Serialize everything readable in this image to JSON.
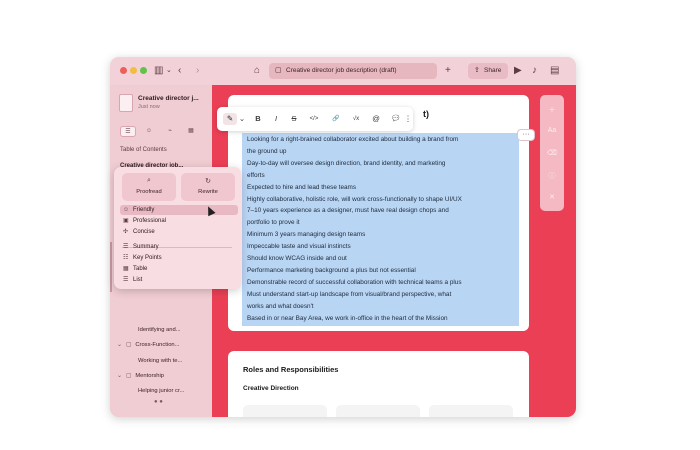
{
  "window": {
    "tab_title": "Creative director job description (draft)",
    "share_label": "Share",
    "icons": [
      "home-icon",
      "sidebar-toggle-icon",
      "back-icon",
      "forward-icon",
      "add-tab-icon",
      "present-icon",
      "notifications-off-icon",
      "window-layout-icon"
    ]
  },
  "sidebar": {
    "doc_title": "Creative director j...",
    "doc_subtitle": "Just now",
    "toc_label": "Table of Contents",
    "current_heading": "Creative director job...",
    "items": [
      {
        "label": "Identifying and...",
        "level": 2
      },
      {
        "label": "Cross-Function...",
        "level": 1
      },
      {
        "label": "Working with te...",
        "level": 2
      },
      {
        "label": "Mentorship",
        "level": 1
      },
      {
        "label": "Helping junior cr...",
        "level": 2
      }
    ]
  },
  "editor": {
    "card1_title": "t)",
    "selected_lines": [
      "Looking for a right-brained collaborator excited about building a brand from",
      "the ground up",
      "Day-to-day will oversee design direction, brand identity, and marketing",
      "efforts",
      "Expected to hire and lead these teams",
      "Highly collaborative, holistic role, will work cross-functionally to shape UI/UX",
      "7–10 years experience as a designer, must have real design chops and",
      "portfolio to prove it",
      "Minimum 3 years managing design teams",
      "Impeccable taste and visual instincts",
      "Should know WCAG inside and out",
      "Performance marketing background a plus but not essential",
      "Demonstrable record of successful collaboration with technical teams a plus",
      "Must understand start-up landscape from visual/brand perspective, what",
      "works and what doesn't",
      "Based in or near Bay Area, we work in-office in the heart of the Mission"
    ],
    "card2_title": "Roles and Responsibilities",
    "card2_subtitle": "Creative Direction",
    "more_label": "···"
  },
  "format_bar": {
    "items": [
      {
        "name": "pen-icon",
        "glyph": "✎",
        "active": true
      },
      {
        "name": "chevron-down-icon",
        "glyph": "⌄",
        "active": false
      },
      {
        "name": "bold-icon",
        "glyph": "B",
        "active": false
      },
      {
        "name": "italic-icon",
        "glyph": "I",
        "active": false
      },
      {
        "name": "strikethrough-icon",
        "glyph": "S",
        "active": false
      },
      {
        "name": "code-icon",
        "glyph": "</>",
        "active": false
      },
      {
        "name": "link-icon",
        "glyph": "🔗",
        "active": false
      },
      {
        "name": "math-icon",
        "glyph": "√x",
        "active": false
      },
      {
        "name": "mention-icon",
        "glyph": "@",
        "active": false
      },
      {
        "name": "comment-icon",
        "glyph": "💬",
        "active": false
      },
      {
        "name": "more-icon",
        "glyph": "⋮",
        "active": false
      }
    ]
  },
  "writing_tools": {
    "proofread_label": "Proofread",
    "rewrite_label": "Rewrite",
    "tone_items": [
      "Friendly",
      "Professional",
      "Concise"
    ],
    "transform_items": [
      "Summary",
      "Key Points",
      "Table",
      "List"
    ],
    "hovered": "Friendly"
  },
  "right_rail_icons": [
    "plus-icon",
    "text-style-icon",
    "trash-icon",
    "info-icon",
    "close-icon"
  ],
  "colors": {
    "canvas": "#ea3f55",
    "selection": "#b9d5f4",
    "sidebar": "#f0ccd3"
  }
}
